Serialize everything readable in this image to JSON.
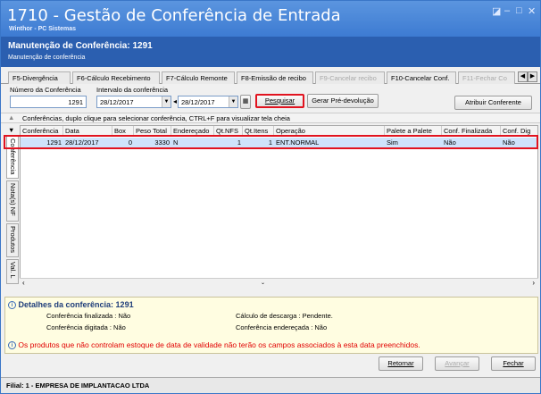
{
  "window": {
    "title": "1710 - Gestão de Conferência de Entrada",
    "subtitle": "Winthor - PC Sistemas",
    "controls": [
      "◪",
      "–",
      "□",
      "✕"
    ]
  },
  "header": {
    "title": "Manutenção de Conferência: 1291",
    "subtitle": "Manutenção de conferência"
  },
  "tabs": [
    {
      "label": "F5-Divergência",
      "enabled": true
    },
    {
      "label": "F6-Cálculo Recebimento",
      "enabled": true
    },
    {
      "label": "F7-Cálculo Remonte",
      "enabled": true
    },
    {
      "label": "F8-Emissão de recibo",
      "enabled": true
    },
    {
      "label": "F9-Cancelar recibo",
      "enabled": false
    },
    {
      "label": "F10-Cancelar Conf.",
      "enabled": true
    },
    {
      "label": "F11-Fechar Co",
      "enabled": false
    }
  ],
  "filters": {
    "numero_label": "Número da Conferência",
    "numero_value": "1291",
    "intervalo_label": "Intervalo da conferência",
    "date_from": "28/12/2017",
    "date_to": "28/12/2017"
  },
  "buttons": {
    "pesquisar": "Pesquisar",
    "gerar": "Gerar Pré-devolução",
    "atribuir": "Atribuir Conferente",
    "retornar": "Retornar",
    "avancar": "Avançar",
    "fechar": "Fechar"
  },
  "hint": "Conferências, duplo clique para selecionar conferência, CTRL+F para visualizar tela cheia",
  "side_tabs": [
    "Conferência",
    "Nota(s) NF",
    "Produtos",
    "Val. L"
  ],
  "table": {
    "columns": [
      "Conferência",
      "Data",
      "Box",
      "Peso Total",
      "Endereçado",
      "Qt.NFS",
      "Qt.Itens",
      "Operação",
      "Palete a Palete",
      "Conf. Finalizada",
      "Conf. Dig"
    ],
    "rows": [
      [
        "1291",
        "28/12/2017",
        "0",
        "3330",
        "N",
        "1",
        "1",
        "ENT.NORMAL",
        "Sim",
        "Não",
        "Não"
      ]
    ]
  },
  "details": {
    "title": "Detalhes da conferência: 1291",
    "finalizada": "Conferência finalizada : Não",
    "digitada": "Conferência digitada : Não",
    "calculo": "Cálculo de descarga : Pendente.",
    "enderecada": "Conferência endereçada : Não",
    "warning": "Os produtos que não controlam estoque de data de validade não terão os campos associados à esta data preenchidos."
  },
  "status": "Filial: 1 - EMPRESA DE IMPLANTACAO LTDA",
  "colors": {
    "accent": "#2b5fb0",
    "highlight": "#e1131f",
    "selected_row": "#cfe3fb"
  }
}
